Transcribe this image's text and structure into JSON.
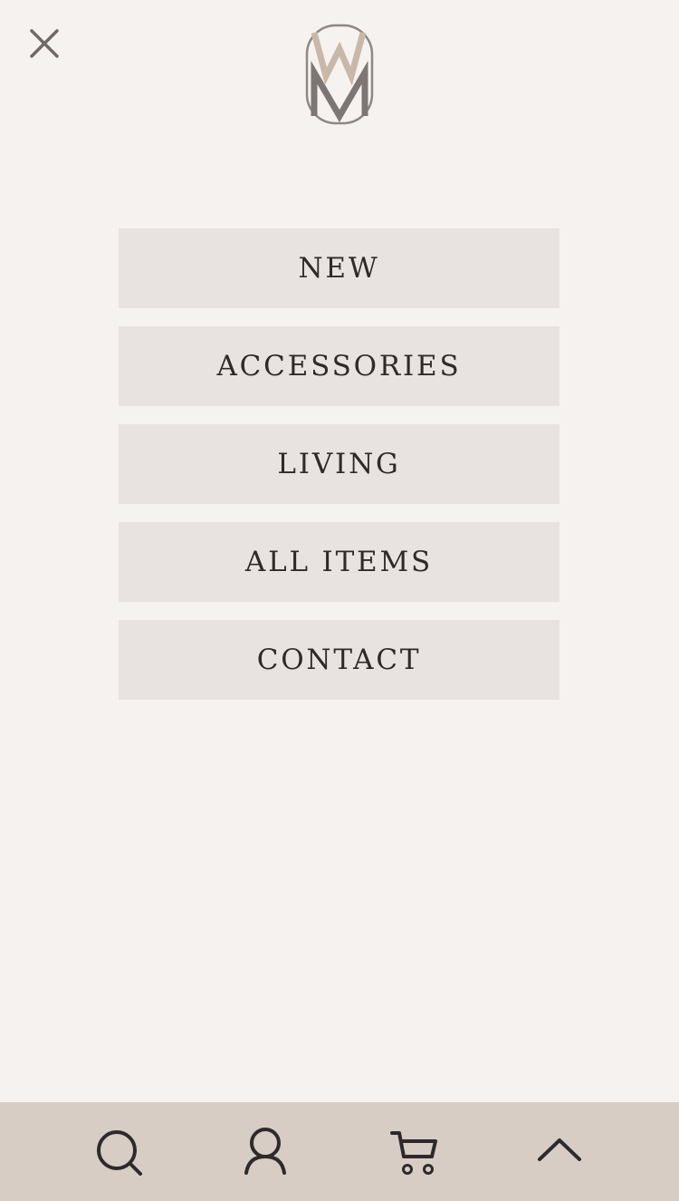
{
  "header": {
    "close_icon": "close-icon",
    "logo_icon": "vm-monogram-logo"
  },
  "menu": {
    "items": [
      {
        "label": "NEW"
      },
      {
        "label": "ACCESSORIES"
      },
      {
        "label": "LIVING"
      },
      {
        "label": "ALL ITEMS"
      },
      {
        "label": "CONTACT"
      }
    ]
  },
  "bottom_bar": {
    "icons": [
      "search-icon",
      "account-icon",
      "cart-icon",
      "chevron-up-icon"
    ]
  },
  "colors": {
    "background": "#f6f2ef",
    "menu_item_background": "#e8e3e1",
    "bottom_bar_background": "#d8cdc5",
    "text": "#2f2a29",
    "logo_beige": "#c9b8aa",
    "logo_gray": "#7c7675"
  }
}
